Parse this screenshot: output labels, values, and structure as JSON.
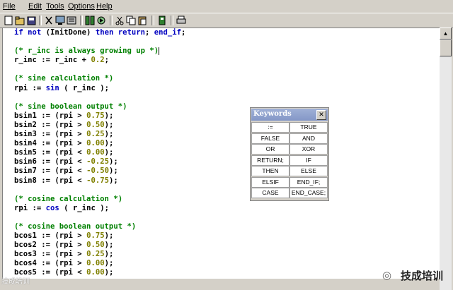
{
  "menu": [
    "File",
    "Edit",
    "Tools",
    "Options",
    "Help"
  ],
  "toolbar": {
    "buttons": [
      "new-file-icon",
      "open-file-icon",
      "save-icon",
      "cut-icon",
      "monitor-icon",
      "settings-icon",
      "compile-icon",
      "run-icon",
      "scissors-icon",
      "copy-icon",
      "paste-icon",
      "debug-icon",
      "print-icon"
    ]
  },
  "code": {
    "lines": [
      [
        [
          "k",
          "if not "
        ],
        [
          "t",
          "(InitDone) "
        ],
        [
          "k",
          "then return"
        ],
        [
          "t",
          "; "
        ],
        [
          "k",
          "end_if"
        ],
        [
          "t",
          ";"
        ]
      ],
      [],
      [
        [
          "c",
          "(* r_inc is always growing up *)"
        ],
        [
          "cur",
          ""
        ]
      ],
      [
        [
          "t",
          "r_inc := r_inc + "
        ],
        [
          "n",
          "0.2"
        ],
        [
          "t",
          ";"
        ]
      ],
      [],
      [
        [
          "c",
          "(* sine calculation *)"
        ]
      ],
      [
        [
          "t",
          "rpi := "
        ],
        [
          "k",
          "sin"
        ],
        [
          "t",
          " ( r_inc );"
        ]
      ],
      [],
      [
        [
          "c",
          "(* sine boolean output *)"
        ]
      ],
      [
        [
          "t",
          "bsin1 := (rpi > "
        ],
        [
          "n",
          "0.75"
        ],
        [
          "t",
          ");"
        ]
      ],
      [
        [
          "t",
          "bsin2 := (rpi > "
        ],
        [
          "n",
          "0.50"
        ],
        [
          "t",
          ");"
        ]
      ],
      [
        [
          "t",
          "bsin3 := (rpi > "
        ],
        [
          "n",
          "0.25"
        ],
        [
          "t",
          ");"
        ]
      ],
      [
        [
          "t",
          "bsin4 := (rpi > "
        ],
        [
          "n",
          "0.00"
        ],
        [
          "t",
          ");"
        ]
      ],
      [
        [
          "t",
          "bsin5 := (rpi < "
        ],
        [
          "n",
          "0.00"
        ],
        [
          "t",
          ");"
        ]
      ],
      [
        [
          "t",
          "bsin6 := (rpi < "
        ],
        [
          "n",
          "-0.25"
        ],
        [
          "t",
          ");"
        ]
      ],
      [
        [
          "t",
          "bsin7 := (rpi < "
        ],
        [
          "n",
          "-0.50"
        ],
        [
          "t",
          ");"
        ]
      ],
      [
        [
          "t",
          "bsin8 := (rpi < "
        ],
        [
          "n",
          "-0.75"
        ],
        [
          "t",
          ");"
        ]
      ],
      [],
      [
        [
          "c",
          "(* cosine calculation *)"
        ]
      ],
      [
        [
          "t",
          "rpi := "
        ],
        [
          "k",
          "cos"
        ],
        [
          "t",
          " ( r_inc );"
        ]
      ],
      [],
      [
        [
          "c",
          "(* cosine boolean output *)"
        ]
      ],
      [
        [
          "t",
          "bcos1 := (rpi > "
        ],
        [
          "n",
          "0.75"
        ],
        [
          "t",
          ");"
        ]
      ],
      [
        [
          "t",
          "bcos2 := (rpi > "
        ],
        [
          "n",
          "0.50"
        ],
        [
          "t",
          ");"
        ]
      ],
      [
        [
          "t",
          "bcos3 := (rpi > "
        ],
        [
          "n",
          "0.25"
        ],
        [
          "t",
          ");"
        ]
      ],
      [
        [
          "t",
          "bcos4 := (rpi > "
        ],
        [
          "n",
          "0.00"
        ],
        [
          "t",
          ");"
        ]
      ],
      [
        [
          "t",
          "bcos5 := (rpi < "
        ],
        [
          "n",
          "0.00"
        ],
        [
          "t",
          ");"
        ]
      ]
    ]
  },
  "keywords": {
    "title": "Keywords",
    "close": "✕",
    "items": [
      ":=",
      "TRUE",
      "FALSE",
      "AND",
      "OR",
      "XOR",
      "RETURN;",
      "IF",
      "THEN",
      "ELSE",
      "ELSIF",
      "END_IF;",
      "CASE",
      "END_CASE;"
    ]
  },
  "watermark": {
    "right": "技成培训",
    "left": "技成培训"
  }
}
